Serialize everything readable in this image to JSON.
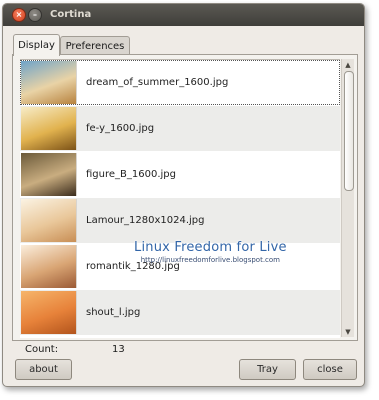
{
  "window": {
    "title": "Cortina",
    "close_glyph": "×",
    "minimize_glyph": "–"
  },
  "tabs": [
    {
      "label": "Display",
      "active": true
    },
    {
      "label": "Preferences",
      "active": false
    }
  ],
  "list": {
    "items": [
      {
        "filename": "dream_of_summer_1600.jpg",
        "thumb_colors": [
          "#6fa3c9",
          "#e9d3a6",
          "#b7823e"
        ]
      },
      {
        "filename": "fe-y_1600.jpg",
        "thumb_colors": [
          "#f7ecc8",
          "#e1b24e",
          "#7c5217"
        ]
      },
      {
        "filename": "figure_B_1600.jpg",
        "thumb_colors": [
          "#6b5a3a",
          "#c9ad80",
          "#3a2b1c"
        ]
      },
      {
        "filename": "Lamour_1280x1024.jpg",
        "thumb_colors": [
          "#fbf3e3",
          "#e9c79a",
          "#c88e55"
        ]
      },
      {
        "filename": "romantik_1280.jpg",
        "thumb_colors": [
          "#fbeedd",
          "#d9a574",
          "#9b5a35"
        ]
      },
      {
        "filename": "shout_l.jpg",
        "thumb_colors": [
          "#f6b56b",
          "#e7823a",
          "#b2541c"
        ]
      }
    ]
  },
  "scrollbar": {
    "up_glyph": "▲",
    "down_glyph": "▼"
  },
  "watermark": {
    "title": "Linux Freedom for Live",
    "url": "http://linuxfreedomforlive.blogspot.com"
  },
  "count": {
    "label": "Count:",
    "value": "13"
  },
  "buttons": {
    "about": "about",
    "tray": "Tray",
    "close": "close"
  }
}
